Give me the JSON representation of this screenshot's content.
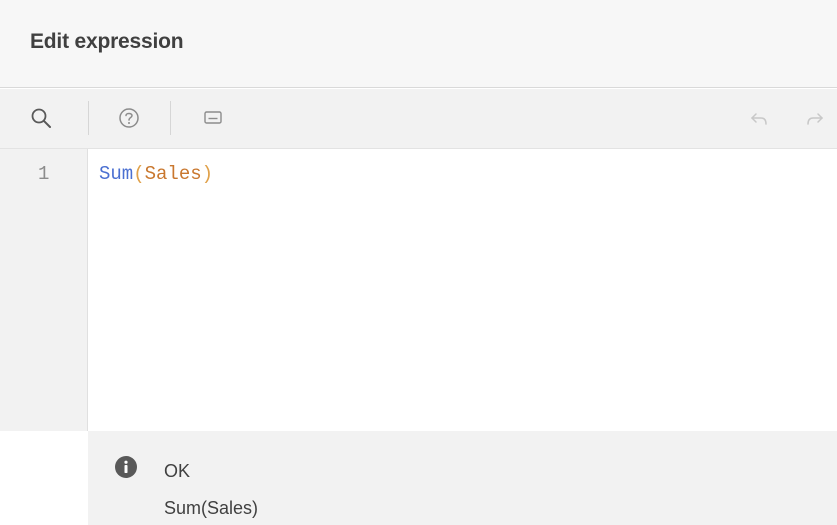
{
  "dialog": {
    "title": "Edit expression"
  },
  "toolbar": {
    "items": [
      {
        "name": "search-icon"
      },
      {
        "name": "help-icon"
      },
      {
        "name": "comment-icon"
      },
      {
        "name": "undo-icon"
      },
      {
        "name": "redo-icon"
      }
    ]
  },
  "editor": {
    "lines": [
      {
        "number": "1",
        "tokens": {
          "func": "Sum",
          "open": "(",
          "field": "Sales",
          "close": ")"
        }
      }
    ]
  },
  "status": {
    "icon": "info-icon",
    "text": "OK",
    "expression": "Sum(Sales)"
  },
  "colors": {
    "function": "#4a6fd1",
    "paren": "#e0a14a",
    "field": "#c9772e",
    "header_bg": "#f7f7f7",
    "panel_bg": "#f2f2f2"
  }
}
